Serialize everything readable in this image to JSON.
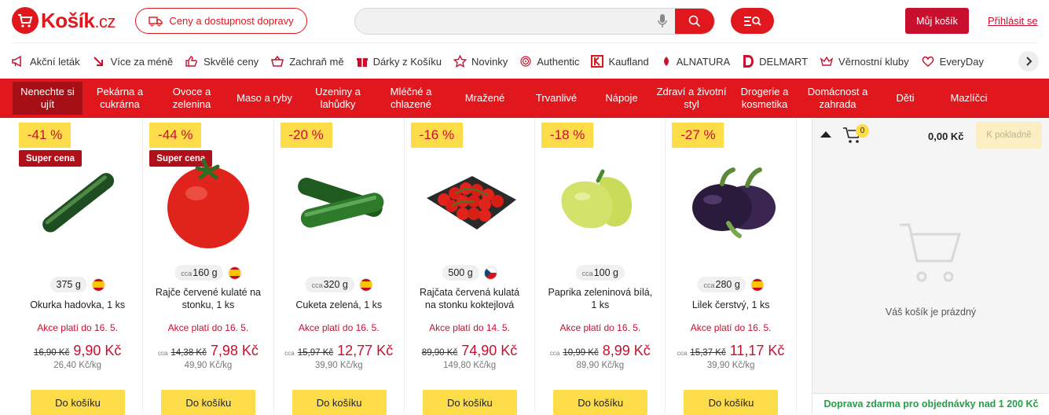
{
  "header": {
    "logo_text": "Košík",
    "logo_suffix": ".cz",
    "delivery_button": "Ceny a dostupnost dopravy",
    "search_placeholder": "",
    "cart_button": "Můj košík",
    "login_link": "Přihlásit se"
  },
  "promo_nav": [
    {
      "label": "Akční leták",
      "icon": "megaphone-icon"
    },
    {
      "label": "Více za méně",
      "icon": "arrow-down-icon"
    },
    {
      "label": "Skvělé ceny",
      "icon": "thumbs-up-icon"
    },
    {
      "label": "Zachraň mě",
      "icon": "rescue-basket-icon"
    },
    {
      "label": "Dárky z Košíku",
      "icon": "gift-icon"
    },
    {
      "label": "Novinky",
      "icon": "star-icon"
    },
    {
      "label": "Authentic",
      "icon": "fingerprint-icon"
    },
    {
      "label": "Kaufland",
      "icon": "kaufland-logo-icon"
    },
    {
      "label": "ALNATURA",
      "icon": "alnatura-logo-icon"
    },
    {
      "label": "DELMART",
      "icon": "delmart-logo-icon"
    },
    {
      "label": "Věrnostní kluby",
      "icon": "crown-icon"
    },
    {
      "label": "EveryDay",
      "icon": "everyday-logo-icon"
    }
  ],
  "categories": [
    {
      "label": "Nenechte si ujít",
      "active": true
    },
    {
      "label": "Pekárna a cukrárna"
    },
    {
      "label": "Ovoce a zelenina"
    },
    {
      "label": "Maso a ryby"
    },
    {
      "label": "Uzeniny a lahůdky"
    },
    {
      "label": "Mléčné a chlazené"
    },
    {
      "label": "Mražené"
    },
    {
      "label": "Trvanlivé"
    },
    {
      "label": "Nápoje"
    },
    {
      "label": "Zdraví a životní styl"
    },
    {
      "label": "Drogerie a kosmetika"
    },
    {
      "label": "Domácnost a zahrada"
    },
    {
      "label": "Děti"
    },
    {
      "label": "Mazlíčci"
    }
  ],
  "products": [
    {
      "discount": "-41 %",
      "super": "Super cena",
      "cca": false,
      "weight": "375 g",
      "flag": "es",
      "name": "Okurka hadovka, 1 ks",
      "valid": "Akce platí do 16. 5.",
      "old_price": "16,90 Kč",
      "new_price": "9,90 Kč",
      "unit_price": "26,40 Kč/kg",
      "add": "Do košíku",
      "image": "cucumber"
    },
    {
      "discount": "-44 %",
      "super": "Super cena",
      "cca": true,
      "weight": "160 g",
      "flag": "es",
      "name": "Rajče červené kulaté na stonku, 1 ks",
      "valid": "Akce platí do 16. 5.",
      "old_price": "14,38 Kč",
      "new_price": "7,98 Kč",
      "unit_price": "49,90 Kč/kg",
      "add": "Do košíku",
      "image": "tomato"
    },
    {
      "discount": "-20 %",
      "super": "",
      "cca": true,
      "weight": "320 g",
      "flag": "es",
      "name": "Cuketa zelená, 1 ks",
      "valid": "Akce platí do 16. 5.",
      "old_price": "15,97 Kč",
      "new_price": "12,77 Kč",
      "unit_price": "39,90 Kč/kg",
      "add": "Do košíku",
      "image": "zucchini"
    },
    {
      "discount": "-16 %",
      "super": "",
      "cca": false,
      "weight": "500 g",
      "flag": "cz",
      "name": "Rajčata červená kulatá na stonku koktejlová",
      "valid": "Akce platí do 14. 5.",
      "old_price": "89,90 Kč",
      "new_price": "74,90 Kč",
      "unit_price": "149,80 Kč/kg",
      "add": "Do košíku",
      "image": "cherry-tomatoes"
    },
    {
      "discount": "-18 %",
      "super": "",
      "cca": true,
      "weight": "100 g",
      "flag": "",
      "name": "Paprika zeleninová bílá, 1 ks",
      "valid": "Akce platí do 16. 5.",
      "old_price": "10,99 Kč",
      "new_price": "8,99 Kč",
      "unit_price": "89,90 Kč/kg",
      "add": "Do košíku",
      "image": "pepper"
    },
    {
      "discount": "-27 %",
      "super": "",
      "cca": true,
      "weight": "280 g",
      "flag": "es",
      "name": "Lilek čerstvý, 1 ks",
      "valid": "Akce platí do 16. 5.",
      "old_price": "15,37 Kč",
      "new_price": "11,17 Kč",
      "unit_price": "39,90 Kč/kg",
      "add": "Do košíku",
      "image": "eggplant"
    }
  ],
  "cca_label": "cca",
  "cart": {
    "badge": "0",
    "total": "0,00 Kč",
    "checkout": "K pokladně",
    "empty_text": "Váš košík je prázdný",
    "free_shipping": "Doprava zdarma pro objednávky nad 1 200 Kč"
  },
  "colors": {
    "brand_red": "#e1171e",
    "discount_yellow": "#fddc4a",
    "price_red": "#c8102e",
    "shipping_green": "#23a046"
  }
}
